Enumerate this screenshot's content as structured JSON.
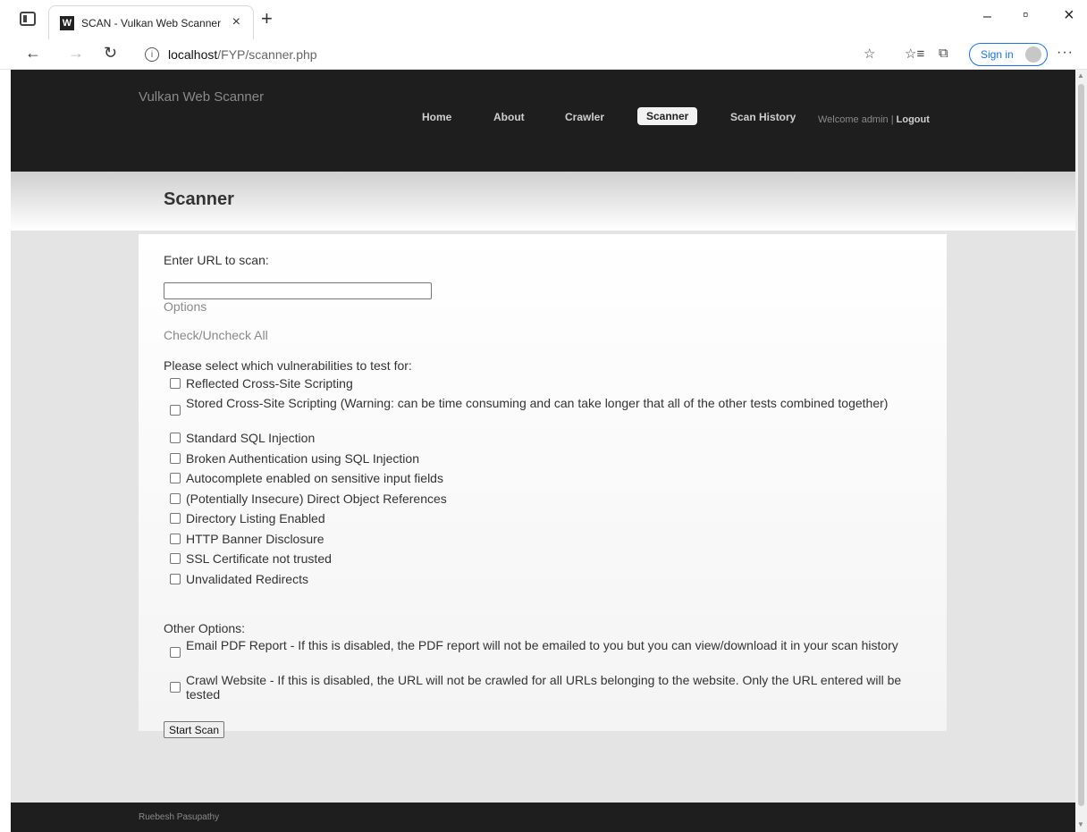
{
  "browser": {
    "tab_title": "SCAN - Vulkan Web Scanner",
    "favicon_letter": "W",
    "url_host": "localhost",
    "url_path": "/FYP/scanner.php",
    "sign_in": "Sign in",
    "new_tab": "+",
    "close_tab": "×",
    "minimize": "–",
    "maximize": "▫",
    "close": "×",
    "more": "···"
  },
  "header": {
    "brand": "Vulkan Web Scanner",
    "nav": [
      {
        "label": "Home"
      },
      {
        "label": "About"
      },
      {
        "label": "Crawler"
      },
      {
        "label": "Scanner",
        "active": true
      },
      {
        "label": "Scan History"
      }
    ],
    "welcome": "Welcome admin | ",
    "logout": "Logout"
  },
  "page": {
    "title": "Scanner",
    "enter_url_label": "Enter URL to scan:",
    "url_value": "",
    "options_label": "Options",
    "check_all_label": "Check/Uncheck All",
    "select_prompt": "Please select which vulnerabilities to test for:",
    "vulnerabilities": [
      "Reflected Cross-Site Scripting",
      "Stored Cross-Site Scripting (Warning: can be time consuming and can take longer that all of the other tests combined together)",
      "Standard SQL Injection",
      "Broken Authentication using SQL Injection",
      "Autocomplete enabled on sensitive input fields",
      "(Potentially Insecure) Direct Object References",
      "Directory Listing Enabled",
      "HTTP Banner Disclosure",
      "SSL Certificate not trusted",
      "Unvalidated Redirects"
    ],
    "other_options_label": "Other Options:",
    "other_options": [
      "Email PDF Report - If this is disabled, the PDF report will not be emailed to you but you can view/download it in your scan history",
      "Crawl Website - If this is disabled, the URL will not be crawled for all URLs belonging to the website. Only the URL entered will be tested"
    ],
    "start_button": "Start Scan"
  },
  "footer": {
    "text": "Ruebesh Pasupathy"
  }
}
